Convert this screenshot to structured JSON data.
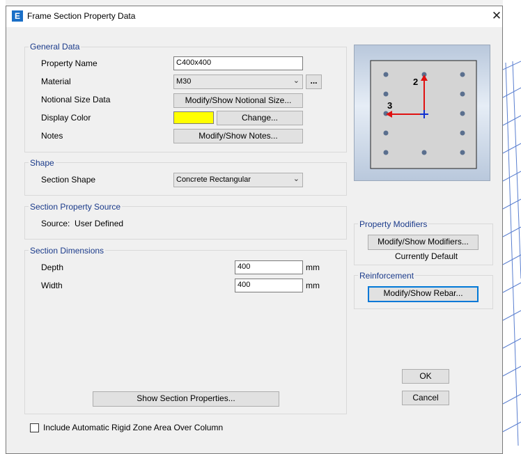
{
  "window": {
    "title": "Frame Section Property Data",
    "close_glyph": "✕",
    "logo_letter": "E"
  },
  "general_data": {
    "group_title": "General Data",
    "property_name_label": "Property Name",
    "property_name_value": "C400x400",
    "material_label": "Material",
    "material_value": "M30",
    "material_more_label": "...",
    "notional_label": "Notional Size Data",
    "notional_button": "Modify/Show Notional Size...",
    "display_color_label": "Display Color",
    "display_color_value": "#ffff00",
    "change_button": "Change...",
    "notes_label": "Notes",
    "notes_button": "Modify/Show Notes..."
  },
  "shape": {
    "group_title": "Shape",
    "section_shape_label": "Section Shape",
    "section_shape_value": "Concrete Rectangular"
  },
  "source": {
    "group_title": "Section Property Source",
    "text": "Source:  User Defined"
  },
  "dimensions": {
    "group_title": "Section Dimensions",
    "depth_label": "Depth",
    "depth_value": "400",
    "depth_unit": "mm",
    "width_label": "Width",
    "width_value": "400",
    "width_unit": "mm",
    "show_properties_button": "Show Section Properties..."
  },
  "preview": {
    "axis_2_label": "2",
    "axis_3_label": "3",
    "rebar_color": "#5a6f8e",
    "axis_color": "#e01010",
    "origin_color": "#1030d0"
  },
  "modifiers": {
    "group_title": "Property Modifiers",
    "button": "Modify/Show Modifiers...",
    "status": "Currently Default"
  },
  "reinforcement": {
    "group_title": "Reinforcement",
    "button": "Modify/Show Rebar..."
  },
  "footer": {
    "checkbox_label": "Include Automatic Rigid Zone Area Over Column",
    "checkbox_checked": false,
    "ok_button": "OK",
    "cancel_button": "Cancel"
  }
}
